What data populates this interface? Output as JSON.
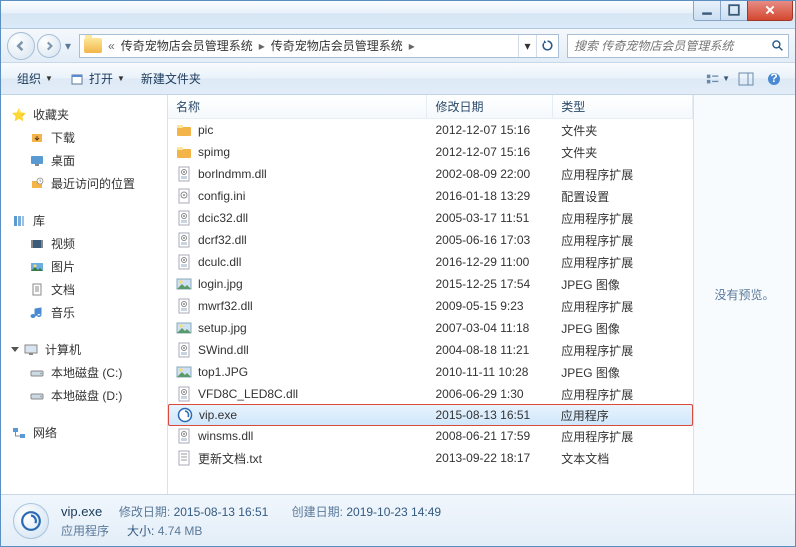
{
  "breadcrumbs": [
    "传奇宠物店会员管理系统",
    "传奇宠物店会员管理系统"
  ],
  "search": {
    "placeholder": "搜索 传奇宠物店会员管理系统"
  },
  "toolbar": {
    "organize": "组织",
    "open": "打开",
    "newfolder": "新建文件夹"
  },
  "sidebar": {
    "favorites": {
      "label": "收藏夹",
      "items": [
        "下载",
        "桌面",
        "最近访问的位置"
      ]
    },
    "libraries": {
      "label": "库",
      "items": [
        "视频",
        "图片",
        "文档",
        "音乐"
      ]
    },
    "computer": {
      "label": "计算机",
      "items": [
        "本地磁盘 (C:)",
        "本地磁盘 (D:)"
      ]
    },
    "network": {
      "label": "网络"
    }
  },
  "columns": {
    "name": "名称",
    "date": "修改日期",
    "type": "类型"
  },
  "cols": {
    "name_w": 260,
    "date_w": 126,
    "type_w": 140
  },
  "preview": {
    "empty": "没有预览。"
  },
  "files": [
    {
      "icon": "folder",
      "name": "pic",
      "date": "2012-12-07 15:16",
      "type": "文件夹"
    },
    {
      "icon": "folder",
      "name": "spimg",
      "date": "2012-12-07 15:16",
      "type": "文件夹"
    },
    {
      "icon": "dll",
      "name": "borlndmm.dll",
      "date": "2002-08-09 22:00",
      "type": "应用程序扩展"
    },
    {
      "icon": "ini",
      "name": "config.ini",
      "date": "2016-01-18 13:29",
      "type": "配置设置"
    },
    {
      "icon": "dll",
      "name": "dcic32.dll",
      "date": "2005-03-17 11:51",
      "type": "应用程序扩展"
    },
    {
      "icon": "dll",
      "name": "dcrf32.dll",
      "date": "2005-06-16 17:03",
      "type": "应用程序扩展"
    },
    {
      "icon": "dll",
      "name": "dculc.dll",
      "date": "2016-12-29 11:00",
      "type": "应用程序扩展"
    },
    {
      "icon": "jpg",
      "name": "login.jpg",
      "date": "2015-12-25 17:54",
      "type": "JPEG 图像"
    },
    {
      "icon": "dll",
      "name": "mwrf32.dll",
      "date": "2009-05-15 9:23",
      "type": "应用程序扩展"
    },
    {
      "icon": "jpg",
      "name": "setup.jpg",
      "date": "2007-03-04 11:18",
      "type": "JPEG 图像",
      "sel": false
    },
    {
      "icon": "dll",
      "name": "SWind.dll",
      "date": "2004-08-18 11:21",
      "type": "应用程序扩展"
    },
    {
      "icon": "jpg",
      "name": "top1.JPG",
      "date": "2010-11-11 10:28",
      "type": "JPEG 图像"
    },
    {
      "icon": "dll",
      "name": "VFD8C_LED8C.dll",
      "date": "2006-06-29 1:30",
      "type": "应用程序扩展"
    },
    {
      "icon": "exe",
      "name": "vip.exe",
      "date": "2015-08-13 16:51",
      "type": "应用程序",
      "sel": true,
      "hl": true
    },
    {
      "icon": "dll",
      "name": "winsms.dll",
      "date": "2008-06-21 17:59",
      "type": "应用程序扩展"
    },
    {
      "icon": "txt",
      "name": "更新文档.txt",
      "date": "2013-09-22 18:17",
      "type": "文本文档"
    }
  ],
  "details": {
    "name": "vip.exe",
    "type": "应用程序",
    "moddate_label": "修改日期:",
    "moddate": "2015-08-13 16:51",
    "createdate_label": "创建日期:",
    "createdate": "2019-10-23 14:49",
    "size_label": "大小:",
    "size": "4.74 MB"
  }
}
